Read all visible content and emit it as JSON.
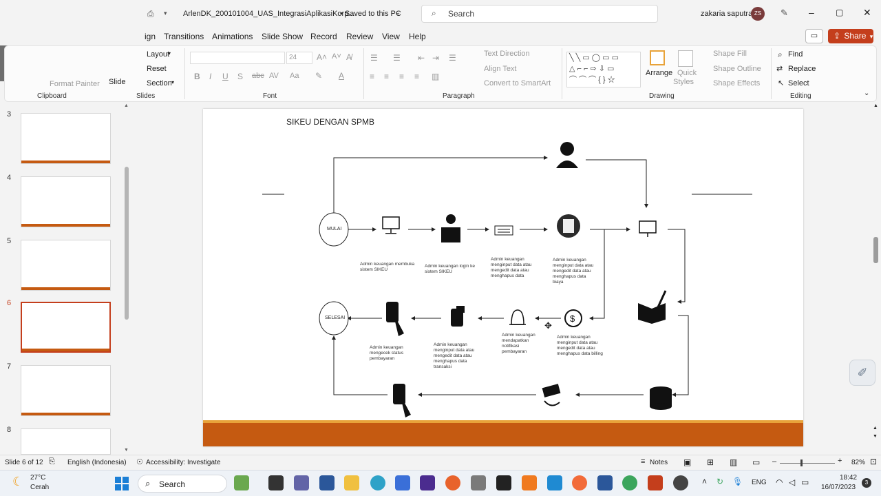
{
  "titlebar": {
    "filename": "ArlenDK_200101004_UAS_IntegrasiAplikasiKorp...",
    "saved": "• Saved to this PC",
    "search_placeholder": "Search",
    "user_name": "zakaria saputra",
    "user_initials": "ZS"
  },
  "menu": {
    "tabs": [
      "ign",
      "Transitions",
      "Animations",
      "Slide Show",
      "Record",
      "Review",
      "View",
      "Help"
    ],
    "share_label": "Share"
  },
  "ribbon": {
    "slides": {
      "layout": "Layout",
      "reset": "Reset",
      "section": "Section",
      "slide": "Slide",
      "format_painter": "Format Painter"
    },
    "font": {
      "font_size": "24"
    },
    "paragraph": {
      "text_direction": "Text Direction",
      "align_text": "Align Text",
      "convert": "Convert to SmartArt"
    },
    "drawing": {
      "arrange": "Arrange",
      "quick": "Quick",
      "styles": "Styles",
      "shape_fill": "Shape Fill",
      "shape_outline": "Shape Outline",
      "shape_effects": "Shape Effects"
    },
    "editing": {
      "find": "Find",
      "replace": "Replace",
      "select": "Select"
    },
    "groups": {
      "clipboard": "Clipboard",
      "slides": "Slides",
      "font": "Font",
      "paragraph": "Paragraph",
      "drawing": "Drawing",
      "editing": "Editing"
    }
  },
  "thumbnails": [
    "3",
    "4",
    "5",
    "6",
    "7",
    "8"
  ],
  "slide": {
    "title": "SIKEU DENGAN SPMB",
    "start": "MULAI",
    "end": "SELESAI",
    "labels": {
      "l1": "Admin keuangan membuka sistem SIKEU",
      "l2": "Admin keuangan login ke sistem SIKEU",
      "l3": "Admin keuangan menginput data atau mengedit data atau menghapus data",
      "l4": "Admin keuangan menginput data atau mengedit data atau menghapus data biaya",
      "l5": "Admin keuangan mengecek status pembayaran",
      "l6": "Admin keuangan menginput data atau mengedit data atau menghapus data transaksi",
      "l7": "Admin keuangan mendapatkan notifikasi pembayaran",
      "l8": "Admin keuangan menginput data atau mengedit data atau menghapus data billing"
    }
  },
  "status": {
    "slide_of": "Slide 6 of 12",
    "language": "English (Indonesia)",
    "accessibility": "Accessibility: Investigate",
    "notes": "Notes",
    "zoom": "82%"
  },
  "taskbar": {
    "weather_temp": "27°C",
    "weather_desc": "Cerah",
    "search": "Search",
    "lang": "ENG",
    "time": "18:42",
    "date": "16/07/2023"
  },
  "colors": {
    "accent": "#c43e1c",
    "slide_band": "#c55a11"
  }
}
